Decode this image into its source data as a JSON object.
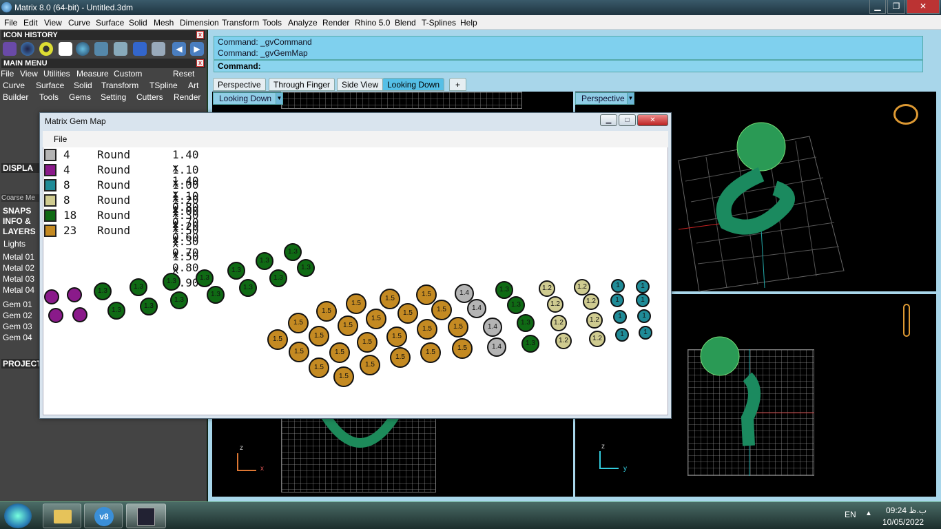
{
  "window": {
    "title": "Matrix 8.0 (64-bit) - Untitled.3dm",
    "min": "▁",
    "max": "❐",
    "close": "✕"
  },
  "menu": [
    "File",
    "Edit",
    "View",
    "Curve",
    "Surface",
    "Solid",
    "Mesh",
    "Dimension",
    "Transform",
    "Tools",
    "Analyze",
    "Render",
    "Rhino 5.0",
    "Blend",
    "T-Splines",
    "Help"
  ],
  "left": {
    "icon_history": "ICON HISTORY",
    "main_menu": "MAIN MENU",
    "mm_row1": [
      "File",
      "View",
      "Utilities",
      "Measure",
      "Custom",
      "Reset"
    ],
    "mm_row2": [
      "Curve",
      "Surface",
      "Solid",
      "Transform",
      "TSpline",
      "Art"
    ],
    "mm_row3": [
      "Builder",
      "Tools",
      "Gems",
      "Setting",
      "Cutters",
      "Render"
    ],
    "display": "DISPLA",
    "coarse": "Coarse Me",
    "snaps": "SNAPS",
    "info": "INFO &",
    "layers": "LAYERS",
    "lights": "Lights",
    "metals": [
      "Metal 01",
      "Metal 02",
      "Metal 03",
      "Metal 04"
    ],
    "gems": [
      "Gem 01",
      "Gem 02",
      "Gem 03",
      "Gem 04"
    ],
    "project": "PROJECT"
  },
  "command": {
    "line1": "Command: _gvCommand",
    "line2": "Command: _gvGemMap",
    "prompt": "Command:"
  },
  "tabs": [
    "Perspective",
    "Through Finger",
    "Side View",
    "Looking Down",
    "+"
  ],
  "viewports": {
    "top_left": "Looking Down",
    "top_right": "Perspective",
    "axis_bl_v": "z",
    "axis_bl_h": "x",
    "axis_br_v": "z",
    "axis_br_h": "y"
  },
  "gem_map": {
    "title": "Matrix Gem Map",
    "file": "File",
    "legend": [
      {
        "count": "4",
        "shape": "Round",
        "size": "1.40 x 1.40 x 0.80",
        "color": "#b4b4b4"
      },
      {
        "count": "4",
        "shape": "Round",
        "size": "1.10 x 1.10 x 0.70",
        "color": "#8a1a8a"
      },
      {
        "count": "8",
        "shape": "Round",
        "size": "1.00 x 1.00 x 0.60",
        "color": "#1f8b97"
      },
      {
        "count": "8",
        "shape": "Round",
        "size": "1.20 x 1.20 x 0.70",
        "color": "#cfcb90"
      },
      {
        "count": "18",
        "shape": "Round",
        "size": "1.30 x 1.30 x 0.80",
        "color": "#0f6a14"
      },
      {
        "count": "23",
        "shape": "Round",
        "size": "1.50 x 1.50 x 0.90",
        "color": "#c48a22"
      }
    ]
  },
  "taskbar": {
    "lang": "EN",
    "time": "ب.ظ 09:24",
    "date": "10/05/2022"
  }
}
